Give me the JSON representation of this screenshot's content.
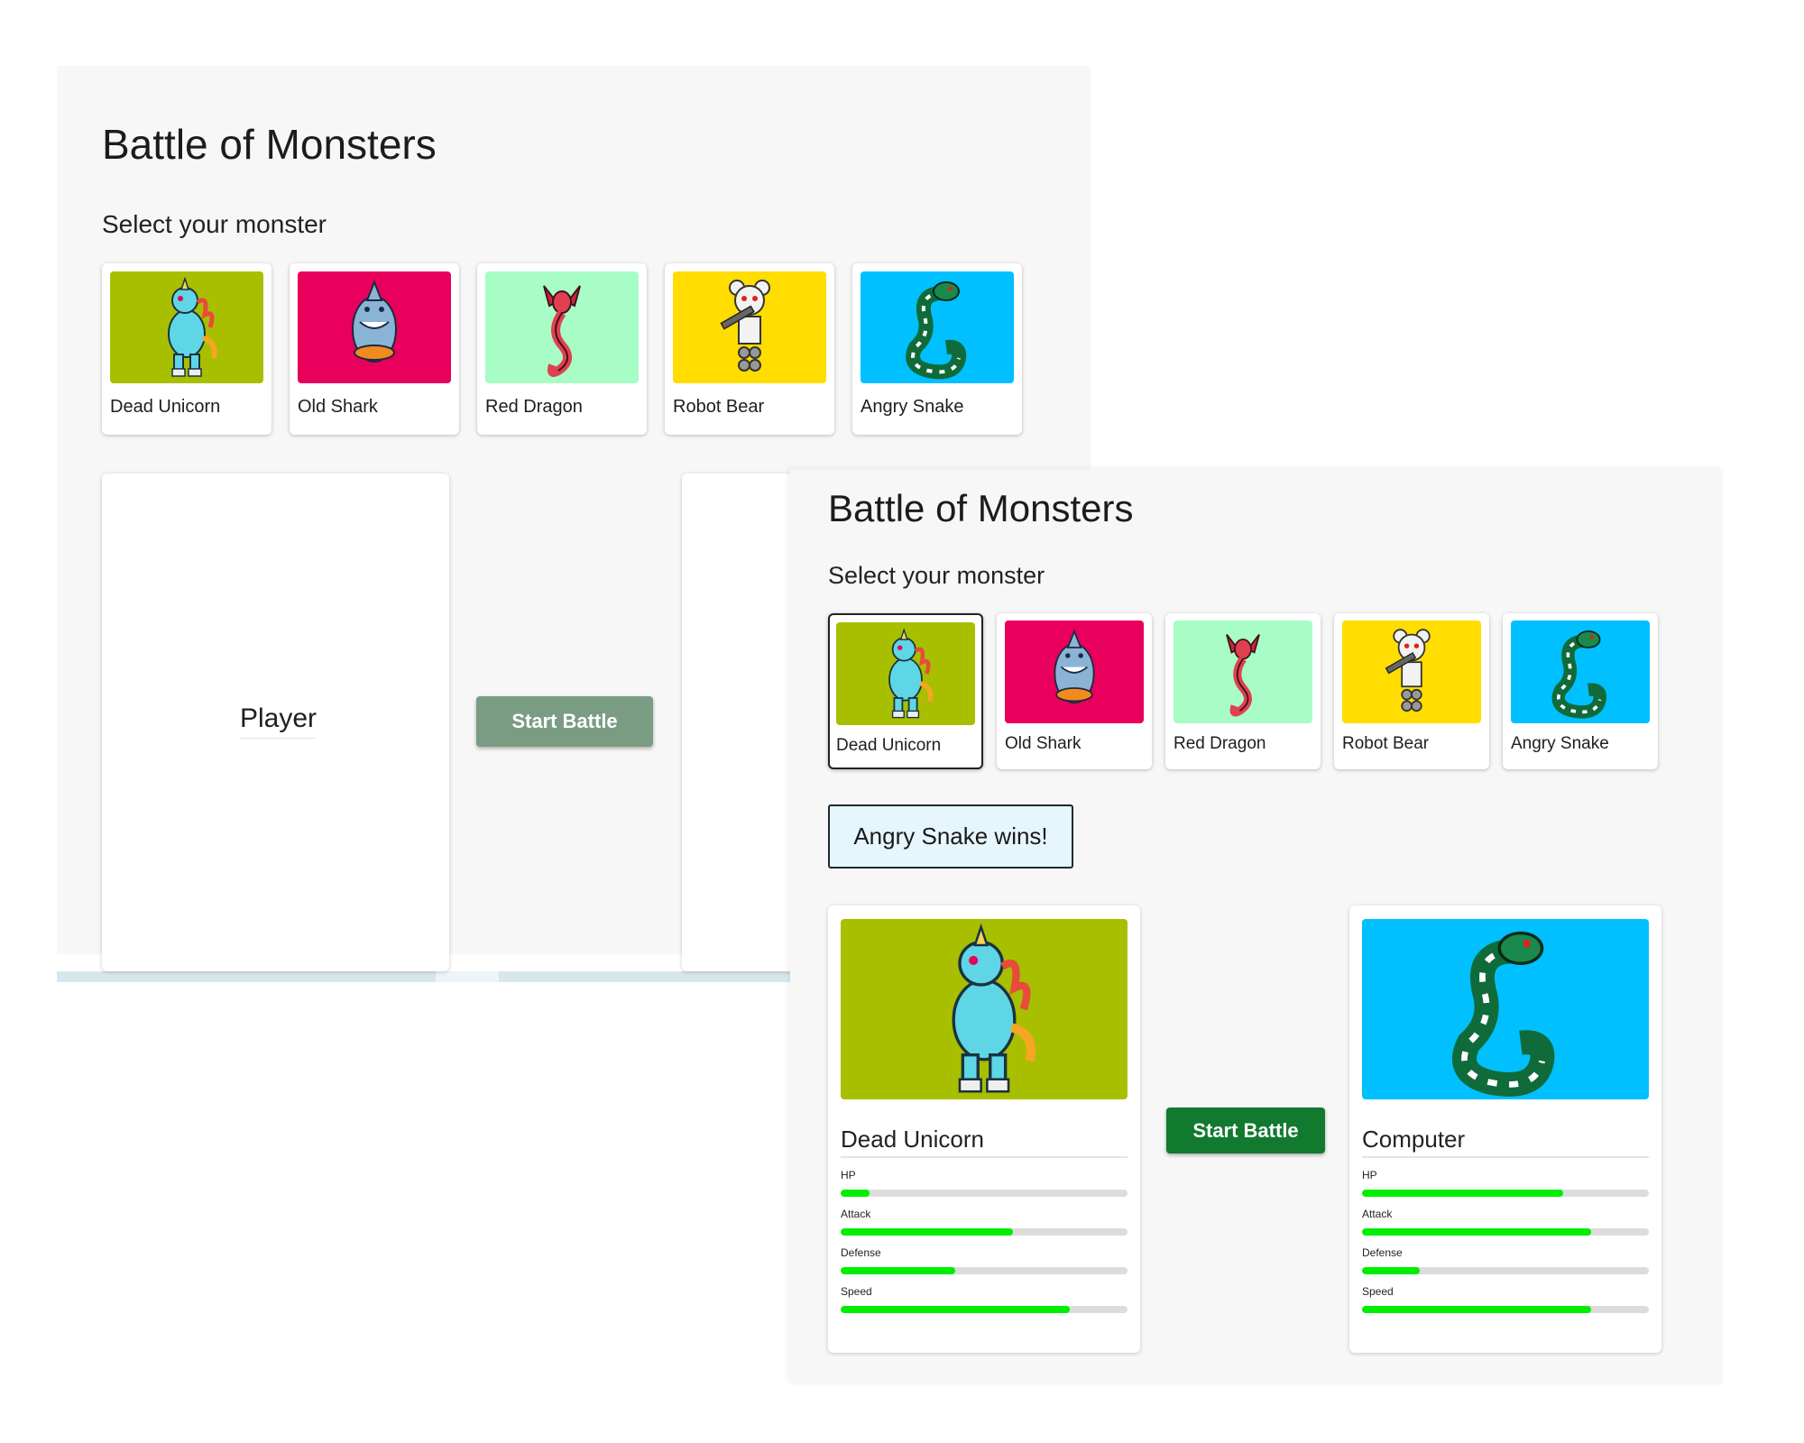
{
  "screen_a": {
    "title": "Battle of Monsters",
    "subtitle": "Select your monster",
    "monsters": [
      {
        "name": "Dead Unicorn",
        "bg": "#a8bf00"
      },
      {
        "name": "Old Shark",
        "bg": "#e8005c"
      },
      {
        "name": "Red Dragon",
        "bg": "#a8fcc6"
      },
      {
        "name": "Robot Bear",
        "bg": "#ffdd00"
      },
      {
        "name": "Angry Snake",
        "bg": "#00c0ff"
      }
    ],
    "player_label": "Player",
    "start_button": "Start Battle",
    "start_button_state": "disabled"
  },
  "screen_b": {
    "title": "Battle of Monsters",
    "subtitle": "Select your monster",
    "selected_monster": "Dead Unicorn",
    "monsters": [
      {
        "name": "Dead Unicorn",
        "bg": "#a8bf00"
      },
      {
        "name": "Old Shark",
        "bg": "#e8005c"
      },
      {
        "name": "Red Dragon",
        "bg": "#a8fcc6"
      },
      {
        "name": "Robot Bear",
        "bg": "#ffdd00"
      },
      {
        "name": "Angry Snake",
        "bg": "#00c0ff"
      }
    ],
    "winner_message": "Angry Snake wins!",
    "start_button": "Start Battle",
    "player": {
      "name": "Dead Unicorn",
      "image_bg": "#a8bf00",
      "stats": [
        {
          "label": "HP",
          "value": 0.1
        },
        {
          "label": "Attack",
          "value": 0.6
        },
        {
          "label": "Defense",
          "value": 0.4
        },
        {
          "label": "Speed",
          "value": 0.8
        }
      ]
    },
    "computer": {
      "name": "Computer",
      "image_bg": "#00c0ff",
      "stats": [
        {
          "label": "HP",
          "value": 0.7
        },
        {
          "label": "Attack",
          "value": 0.8
        },
        {
          "label": "Defense",
          "value": 0.2
        },
        {
          "label": "Speed",
          "value": 0.8
        }
      ]
    }
  },
  "colors": {
    "panel_bg": "#f7f7f7",
    "stat_fill": "#00ee00",
    "stat_track": "#dcdcdc",
    "button_active": "#117a2f",
    "button_disabled": "#7a9c83",
    "winner_bg": "#e6f6fd"
  },
  "icons": [
    "unicorn-icon",
    "shark-icon",
    "dragon-icon",
    "robot-bear-icon",
    "snake-icon"
  ]
}
